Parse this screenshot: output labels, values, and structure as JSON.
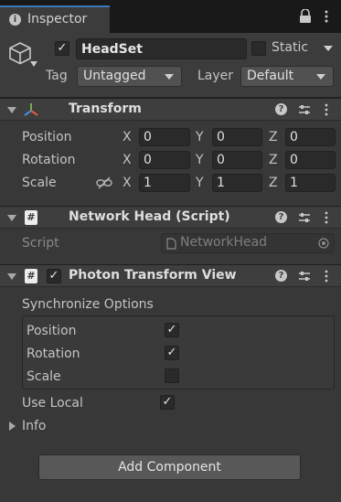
{
  "tab": {
    "title": "Inspector"
  },
  "gameobject": {
    "active_check": "✓",
    "name": "HeadSet",
    "static_label": "Static",
    "tag_label": "Tag",
    "tag_value": "Untagged",
    "layer_label": "Layer",
    "layer_value": "Default"
  },
  "transform": {
    "title": "Transform",
    "help": "?",
    "position": {
      "label": "Position",
      "x": "0",
      "y": "0",
      "z": "0"
    },
    "rotation": {
      "label": "Rotation",
      "x": "0",
      "y": "0",
      "z": "0"
    },
    "scale": {
      "label": "Scale",
      "x": "1",
      "y": "1",
      "z": "1"
    },
    "axis_x": "X",
    "axis_y": "Y",
    "axis_z": "Z"
  },
  "network_head": {
    "title": "Network Head (Script)",
    "help": "?",
    "icon_glyph": "#",
    "script_label": "Script",
    "script_value": "NetworkHead"
  },
  "photon": {
    "title": "Photon Transform View",
    "help": "?",
    "icon_glyph": "#",
    "enabled_check": "✓",
    "sync_label": "Synchronize Options",
    "position_label": "Position",
    "position_check": "✓",
    "rotation_label": "Rotation",
    "rotation_check": "✓",
    "scale_label": "Scale",
    "scale_check": "",
    "use_local_label": "Use Local",
    "use_local_check": "✓",
    "info_label": "Info"
  },
  "add_component": "Add Component",
  "colors": {
    "tab_accent": "#3a79bb",
    "background": "#383838"
  }
}
